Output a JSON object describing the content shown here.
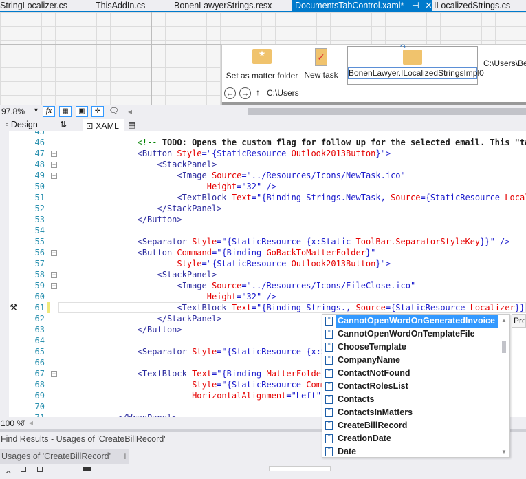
{
  "tabs": [
    {
      "label": "StringLocalizer.cs",
      "active": false
    },
    {
      "label": "ThisAddIn.cs",
      "active": false
    },
    {
      "label": "BonenLawyerStrings.resx",
      "active": false
    },
    {
      "label": "DocumentsTabControl.xaml*",
      "active": true
    },
    {
      "label": "ILocalizedStrings.cs",
      "active": false
    }
  ],
  "preview": {
    "set_matter_folder": "Set as matter folder",
    "new_task": "New task",
    "selected_text": "BonenLawyer.ILocalizedStringsImpl0",
    "path_right": "C:\\Users\\Ben",
    "nav_path": "C:\\Users"
  },
  "designer_toolbar": {
    "zoom": "97.8%",
    "fx": "fx"
  },
  "splitter": {
    "design": "Design",
    "swap": "⇅",
    "xaml": "XAML"
  },
  "editor": {
    "current_line": 61,
    "lines": [
      {
        "n": "45",
        "indent": "",
        "segs": []
      },
      {
        "n": "46",
        "indent": "                ",
        "segs": [
          [
            "c",
            "<!-- "
          ],
          [
            "k",
            "TODO: Opens the custom flag for follow up for the selected email. This \"task"
          ]
        ]
      },
      {
        "n": "47",
        "fold": true,
        "indent": "                ",
        "segs": [
          [
            "t",
            "<Button "
          ],
          [
            "a",
            "Style"
          ],
          [
            "v",
            "=\"{StaticResource "
          ],
          [
            "a",
            "Outlook2013Button"
          ],
          [
            "v",
            "}\">"
          ]
        ]
      },
      {
        "n": "48",
        "fold": true,
        "indent": "                    ",
        "segs": [
          [
            "t",
            "<StackPanel>"
          ]
        ]
      },
      {
        "n": "49",
        "fold": true,
        "indent": "                        ",
        "segs": [
          [
            "t",
            "<Image "
          ],
          [
            "a",
            "Source"
          ],
          [
            "v",
            "=\"../Resources/Icons/NewTask.ico\""
          ]
        ]
      },
      {
        "n": "50",
        "indent": "                              ",
        "segs": [
          [
            "a",
            "Height"
          ],
          [
            "v",
            "=\"32\" />"
          ]
        ]
      },
      {
        "n": "51",
        "indent": "                        ",
        "segs": [
          [
            "t",
            "<TextBlock "
          ],
          [
            "a",
            "Text"
          ],
          [
            "v",
            "=\"{Binding Strings.NewTask, "
          ],
          [
            "a",
            "Source"
          ],
          [
            "v",
            "={StaticResource "
          ],
          [
            "a",
            "Localiz"
          ]
        ]
      },
      {
        "n": "52",
        "indent": "                    ",
        "segs": [
          [
            "t",
            "</StackPanel>"
          ]
        ]
      },
      {
        "n": "53",
        "indent": "                ",
        "segs": [
          [
            "t",
            "</Button>"
          ]
        ]
      },
      {
        "n": "54",
        "indent": "",
        "segs": []
      },
      {
        "n": "55",
        "indent": "                ",
        "segs": [
          [
            "t",
            "<Separator "
          ],
          [
            "a",
            "Style"
          ],
          [
            "v",
            "=\"{StaticResource {x:Static "
          ],
          [
            "a",
            "ToolBar.SeparatorStyleKey"
          ],
          [
            "v",
            "}}\" />"
          ]
        ]
      },
      {
        "n": "56",
        "fold": true,
        "indent": "                ",
        "segs": [
          [
            "t",
            "<Button "
          ],
          [
            "a",
            "Command"
          ],
          [
            "v",
            "=\"{Binding "
          ],
          [
            "a",
            "GoBackToMatterFolder"
          ],
          [
            "v",
            "}\""
          ]
        ]
      },
      {
        "n": "57",
        "indent": "                        ",
        "segs": [
          [
            "a",
            "Style"
          ],
          [
            "v",
            "=\"{StaticResource "
          ],
          [
            "a",
            "Outlook2013Button"
          ],
          [
            "v",
            "}\">"
          ]
        ]
      },
      {
        "n": "58",
        "fold": true,
        "indent": "                    ",
        "segs": [
          [
            "t",
            "<StackPanel>"
          ]
        ]
      },
      {
        "n": "59",
        "fold": true,
        "indent": "                        ",
        "segs": [
          [
            "t",
            "<Image "
          ],
          [
            "a",
            "Source"
          ],
          [
            "v",
            "=\"../Resources/Icons/FileClose.ico\""
          ]
        ]
      },
      {
        "n": "60",
        "indent": "                              ",
        "segs": [
          [
            "a",
            "Height"
          ],
          [
            "v",
            "=\"32\" />"
          ]
        ]
      },
      {
        "n": "61",
        "indent": "                        ",
        "segs": [
          [
            "t",
            "<TextBlock "
          ],
          [
            "a",
            "Text"
          ],
          [
            "v",
            "=\"{Binding Strings., "
          ],
          [
            "a",
            "Source"
          ],
          [
            "v",
            "={StaticResource "
          ],
          [
            "a",
            "Localizer"
          ],
          [
            "v",
            "}}\" /"
          ]
        ]
      },
      {
        "n": "62",
        "indent": "                    ",
        "segs": [
          [
            "t",
            "</StackPanel>"
          ]
        ]
      },
      {
        "n": "63",
        "indent": "                ",
        "segs": [
          [
            "t",
            "</Button>"
          ]
        ]
      },
      {
        "n": "64",
        "indent": "",
        "segs": []
      },
      {
        "n": "65",
        "indent": "                ",
        "segs": [
          [
            "t",
            "<Separator "
          ],
          [
            "a",
            "Style"
          ],
          [
            "v",
            "=\"{StaticResource {x:St"
          ]
        ]
      },
      {
        "n": "66",
        "indent": "",
        "segs": []
      },
      {
        "n": "67",
        "fold": true,
        "indent": "                ",
        "segs": [
          [
            "t",
            "<TextBlock "
          ],
          [
            "a",
            "Text"
          ],
          [
            "v",
            "=\"{Binding "
          ],
          [
            "a",
            "MatterFolder"
          ],
          [
            "v",
            "}"
          ]
        ]
      },
      {
        "n": "68",
        "indent": "                           ",
        "segs": [
          [
            "a",
            "Style"
          ],
          [
            "v",
            "=\"{StaticResource "
          ],
          [
            "a",
            "Comma"
          ]
        ]
      },
      {
        "n": "69",
        "indent": "                           ",
        "segs": [
          [
            "a",
            "HorizontalAlignment"
          ],
          [
            "v",
            "=\"Left\" /"
          ]
        ]
      },
      {
        "n": "70",
        "indent": "",
        "segs": []
      },
      {
        "n": "71",
        "indent": "            ",
        "segs": [
          [
            "t",
            "</WrapPanel>"
          ]
        ]
      }
    ]
  },
  "autocomplete": {
    "items": [
      "CannotOpenWordOnGeneratedInvoice",
      "CannotOpenWordOnTemplateFile",
      "ChooseTemplate",
      "CompanyName",
      "ContactNotFound",
      "ContactRolesList",
      "Contacts",
      "ContactsInMatters",
      "CreateBillRecord",
      "CreationDate",
      "Date"
    ],
    "selected_index": 0,
    "tooltip": "Pro",
    "selection_color": "#3399ff"
  },
  "editor_zoom": "100 %",
  "find_results": {
    "title": "Find Results - Usages of 'CreateBillRecord'",
    "tab": "Usages of 'CreateBillRecord'"
  },
  "accent": "#007acc"
}
